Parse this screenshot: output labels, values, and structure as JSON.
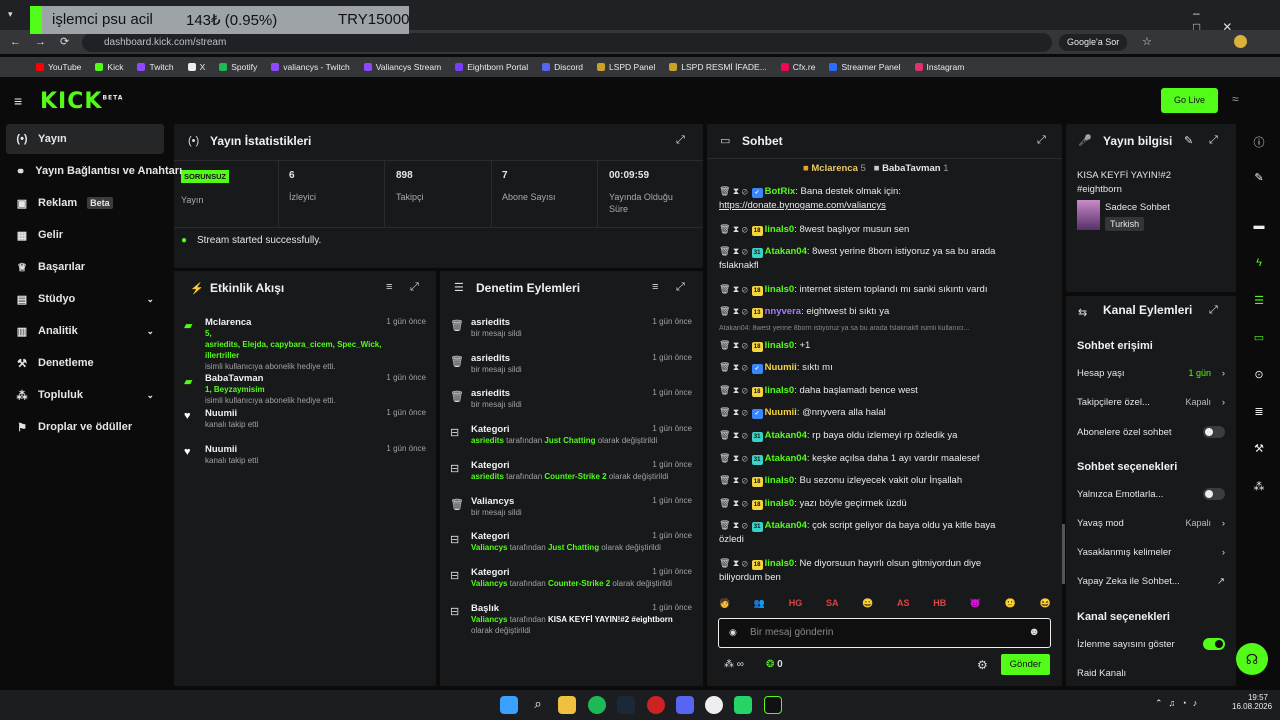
{
  "overlay": {
    "text": "işlemci psu acil",
    "amount": "143₺ (0.95%)",
    "goal": "TRY15000"
  },
  "browser": {
    "url": "dashboard.kick.com/stream",
    "search_button": "Google'a Sor"
  },
  "bookmarks": [
    {
      "label": "YouTube",
      "color": "#ff0000"
    },
    {
      "label": "Kick",
      "color": "#53fc18"
    },
    {
      "label": "Twitch",
      "color": "#9146ff"
    },
    {
      "label": "X",
      "color": "#eeeeee"
    },
    {
      "label": "Spotify",
      "color": "#1db954"
    },
    {
      "label": "valiancys - Twitch",
      "color": "#9146ff"
    },
    {
      "label": "Valiancys Stream",
      "color": "#9146ff"
    },
    {
      "label": "Eightborn Portal",
      "color": "#7a3cff"
    },
    {
      "label": "Discord",
      "color": "#5865f2"
    },
    {
      "label": "LSPD Panel",
      "color": "#c9a227"
    },
    {
      "label": "LSPD  RESMİ İFADE...",
      "color": "#c9a227"
    },
    {
      "label": "Cfx.re",
      "color": "#f40552"
    },
    {
      "label": "Streamer Panel",
      "color": "#2b6cff"
    },
    {
      "label": "Instagram",
      "color": "#e1306c"
    }
  ],
  "header": {
    "logo": "KICK",
    "logo_sup": "BETA",
    "go_live": "Go Live"
  },
  "sidebar": [
    {
      "label": "Yayın",
      "icon": "broadcast-icon"
    },
    {
      "label": "Yayın Bağlantısı ve Anahtarı",
      "icon": "link-icon"
    },
    {
      "label": "Reklam",
      "badge": "Beta",
      "icon": "ad-icon"
    },
    {
      "label": "Gelir",
      "icon": "revenue-icon"
    },
    {
      "label": "Başarılar",
      "icon": "trophy-icon"
    },
    {
      "label": "Stüdyo",
      "icon": "studio-icon"
    },
    {
      "label": "Analitik",
      "icon": "analytics-icon"
    },
    {
      "label": "Denetleme",
      "icon": "hammer-icon"
    },
    {
      "label": "Topluluk",
      "icon": "community-icon"
    },
    {
      "label": "Droplar ve ödüller",
      "icon": "gift-icon"
    }
  ],
  "stats": {
    "title": "Yayın İstatistikleri",
    "status_badge": "SORUNSUZ",
    "status_label": "Yayın",
    "viewers": "6",
    "viewers_label": "İzleyici",
    "followers": "898",
    "followers_label": "Takipçi",
    "subs": "7",
    "subs_label": "Abone Sayısı",
    "duration": "00:09:59",
    "duration_label": "Yayında Olduğu Süre",
    "success": "Stream started successfully."
  },
  "activity": {
    "title": "Etkinlik Akışı",
    "items": [
      {
        "name": "Mclarenca",
        "time": "1 gün önce",
        "line1": "5,",
        "line2": "asriedits, Elejda, capybara_cicem, Spec_Wick, illertriller",
        "line3": "isimli kullanıcıya abonelik hediye etti."
      },
      {
        "name": "BabaTavman",
        "time": "1 gün önce",
        "line1": "1, Beyzaymisim",
        "line2": "isimli kullanıcıya abonelik hediye etti."
      },
      {
        "name": "Nuumii",
        "time": "1 gün önce",
        "line1": "kanalı takip etti"
      },
      {
        "name": "Nuumii",
        "time": "1 gün önce",
        "line1": "kanalı takip etti"
      }
    ]
  },
  "mod": {
    "title": "Denetim Eylemleri",
    "items": [
      {
        "name": "asriedits",
        "time": "1 gün önce",
        "d": "bir mesajı sildi"
      },
      {
        "name": "asriedits",
        "time": "1 gün önce",
        "d": "bir mesajı sildi"
      },
      {
        "name": "asriedits",
        "time": "1 gün önce",
        "d": "bir mesajı sildi"
      },
      {
        "name": "Kategori",
        "time": "1 gün önce",
        "who": "asriedits",
        "mid": " tarafından ",
        "what": "Just Chatting",
        "end": " olarak değiştirildi"
      },
      {
        "name": "Kategori",
        "time": "1 gün önce",
        "who": "asriedits",
        "mid": " tarafından ",
        "what": "Counter-Strike 2",
        "end": " olarak değiştirildi"
      },
      {
        "name": "Valiancys",
        "time": "1 gün önce",
        "d": "bir mesajı sildi"
      },
      {
        "name": "Kategori",
        "time": "1 gün önce",
        "who": "Valiancys",
        "mid": " tarafından ",
        "what": "Just Chatting",
        "end": " olarak değiştirildi"
      },
      {
        "name": "Kategori",
        "time": "1 gün önce",
        "who": "Valiancys",
        "mid": " tarafından ",
        "what": "Counter-Strike 2",
        "end": " olarak değiştirildi"
      },
      {
        "name": "Başlık",
        "time": "1 gün önce",
        "who": "Valiancys",
        "mid": " tarafından ",
        "what": "KISA KEYFİ YAYIN!#2 #eightborn",
        "end": " olarak değiştirildi"
      }
    ]
  },
  "chat": {
    "title": "Sohbet",
    "top1": "Mclarenca",
    "top1n": "5",
    "top2": "BabaTavman",
    "top2n": "1",
    "placeholder": "Bir mesaj gönderin",
    "send": "Gönder",
    "points": "0",
    "reply": "Atakan04: 8west yerine 8born istiyoruz ya sa bu arada fslaknakfl isimli kullanıcı...",
    "messages": [
      {
        "user": "BotRix",
        "color": "#53fc18",
        "badge": "",
        "text": "Bana destek olmak için:",
        "text2": "https://donate.bynogame.com/valiancys"
      },
      {
        "user": "linals0",
        "color": "#53fc18",
        "badge": "18",
        "text": "8west başlıyor musun sen"
      },
      {
        "user": "Atakan04",
        "color": "#53fc18",
        "badge": "31",
        "text": "8west yerine 8born istiyoruz ya sa bu arada",
        "text2": "fslaknakfl"
      },
      {
        "user": "linals0",
        "color": "#53fc18",
        "badge": "18",
        "text": "internet sistem toplandı mı sanki sıkıntı vardı"
      },
      {
        "user": "nnyvera",
        "color": "#a77bff",
        "badge": "13",
        "text": "eightwest bi sıktı ya"
      },
      {
        "user": "linals0",
        "color": "#53fc18",
        "badge": "18",
        "text": "+1"
      },
      {
        "user": "Nuumii",
        "color": "#f5d442",
        "badge": "",
        "text": "sıktı mı"
      },
      {
        "user": "linals0",
        "color": "#53fc18",
        "badge": "18",
        "text": "daha başlamadı bence west"
      },
      {
        "user": "Nuumii",
        "color": "#f5d442",
        "badge": "",
        "text": "@nnyvera alla halal"
      },
      {
        "user": "Atakan04",
        "color": "#53fc18",
        "badge": "31",
        "text": "rp baya oldu izlemeyi rp özledik ya"
      },
      {
        "user": "Atakan04",
        "color": "#53fc18",
        "badge": "31",
        "text": "keşke açılsa daha 1 ayı vardır maalesef"
      },
      {
        "user": "linals0",
        "color": "#53fc18",
        "badge": "18",
        "text": "Bu sezonu izleyecek vakit olur İnşallah"
      },
      {
        "user": "linals0",
        "color": "#53fc18",
        "badge": "18",
        "text": "yazı böyle geçirmek üzdü"
      },
      {
        "user": "Atakan04",
        "color": "#53fc18",
        "badge": "31",
        "text": "çok script geliyor da baya oldu ya kitle baya",
        "text2": "özledi"
      },
      {
        "user": "linals0",
        "color": "#53fc18",
        "badge": "18",
        "text": "Ne diyorsuun hayırlı olsun gitmiyordun diye",
        "text2": "biliyordum ben"
      }
    ],
    "emotes": [
      "🧑",
      "👥",
      "HG",
      "SA",
      "😀",
      "AS",
      "HB",
      "😈",
      "🙂",
      "😆"
    ]
  },
  "info": {
    "title": "Yayın bilgisi",
    "stream_title": "KISA KEYFİ YAYIN!#2",
    "tag": "#eightborn",
    "category": "Sadece Sohbet",
    "language": "Turkish"
  },
  "channel": {
    "title": "Kanal Eylemleri",
    "chat_access": "Sohbet erişimi",
    "account_age": "Hesap yaşı",
    "account_age_v": "1 gün",
    "followers_only": "Takipçilere özel...",
    "followers_only_v": "Kapalı",
    "subs_only": "Abonelere özel sohbet",
    "chat_options": "Sohbet seçenekleri",
    "emotes_only": "Yalnızca Emotlarla...",
    "slow": "Yavaş mod",
    "slow_v": "Kapalı",
    "banned": "Yasaklanmış kelimeler",
    "ai": "Yapay Zeka ile Sohbet...",
    "channel_options": "Kanal seçenekleri",
    "show_views": "İzlenme sayısını göster",
    "raid": "Raid Kanalı"
  },
  "clock": {
    "time": "19:57",
    "date": "16.08.2026"
  }
}
